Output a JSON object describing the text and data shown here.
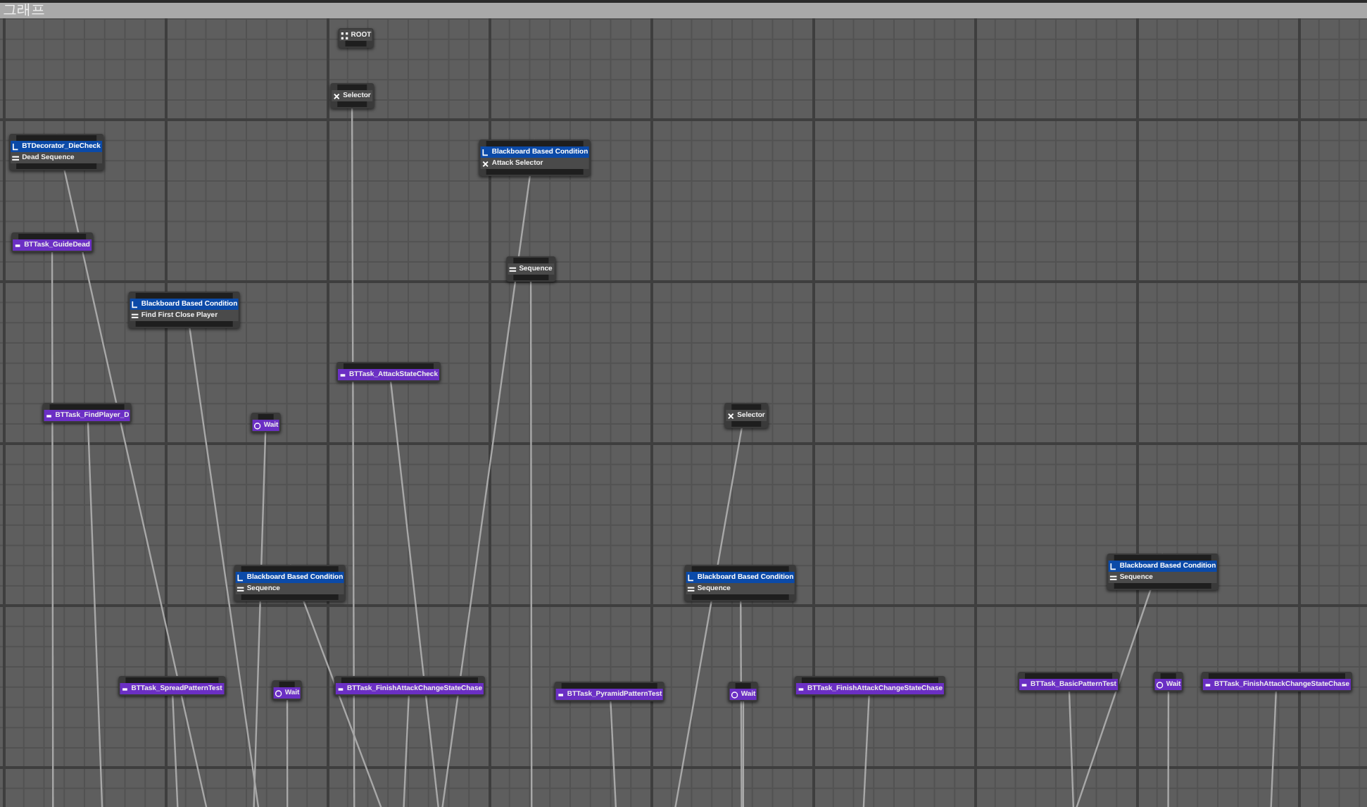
{
  "tab": {
    "title": "그래프"
  },
  "tree": {
    "kind": "root",
    "label": "ROOT",
    "children": [
      {
        "kind": "selector",
        "label": "Selector",
        "children": [
          {
            "kind": "sequence",
            "decorator": "BTDecorator_DieCheck",
            "label": "Dead Sequence",
            "children": [
              {
                "kind": "task",
                "label": "BTTask_GuideDead"
              }
            ]
          },
          {
            "kind": "sequence",
            "decorator": "Blackboard Based Condition",
            "label": "Find First Close Player",
            "children": [
              {
                "kind": "task",
                "label": "BTTask_FindPlayer_D"
              },
              {
                "kind": "wait",
                "label": "Wait"
              }
            ]
          },
          {
            "kind": "selector",
            "decorator": "Blackboard Based Condition",
            "label": "Attack Selector",
            "children": [
              {
                "kind": "sequence",
                "label": "Sequence",
                "children": [
                  {
                    "kind": "task",
                    "label": "BTTask_AttackStateCheck"
                  },
                  {
                    "kind": "selector",
                    "label": "Selector",
                    "children": [
                      {
                        "kind": "sequence",
                        "decorator": "Blackboard Based Condition",
                        "label": "Sequence",
                        "children": [
                          {
                            "kind": "task",
                            "label": "BTTask_SpreadPatternTest"
                          },
                          {
                            "kind": "wait",
                            "label": "Wait"
                          },
                          {
                            "kind": "task",
                            "label": "BTTask_FinishAttackChangeStateChase"
                          }
                        ]
                      },
                      {
                        "kind": "sequence",
                        "decorator": "Blackboard Based Condition",
                        "label": "Sequence",
                        "children": [
                          {
                            "kind": "task",
                            "label": "BTTask_PyramidPatternTest"
                          },
                          {
                            "kind": "wait",
                            "label": "Wait"
                          },
                          {
                            "kind": "task",
                            "label": "BTTask_FinishAttackChangeStateChase"
                          }
                        ]
                      },
                      {
                        "kind": "sequence",
                        "decorator": "Blackboard Based Condition",
                        "label": "Sequence",
                        "children": [
                          {
                            "kind": "task",
                            "label": "BTTask_BasicPatternTest"
                          },
                          {
                            "kind": "wait",
                            "label": "Wait"
                          },
                          {
                            "kind": "task",
                            "label": "BTTask_FinishAttackChangeStateChase"
                          }
                        ]
                      }
                    ]
                  }
                ]
              }
            ]
          }
        ]
      }
    ]
  }
}
